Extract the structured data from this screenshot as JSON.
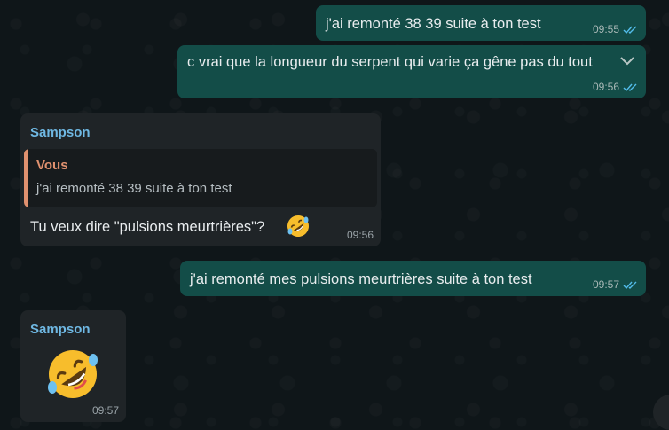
{
  "colors": {
    "outgoing_bubble": "#134d48",
    "incoming_bubble": "#1f2427",
    "sender_name": "#6fb8e3",
    "quote_accent": "#e0916f",
    "read_ticks": "#53bdeb"
  },
  "messages": [
    {
      "direction": "outgoing",
      "text": "j'ai remonté 38 39 suite à ton test",
      "time": "09:55",
      "status": "read"
    },
    {
      "direction": "outgoing",
      "text": "c vrai que la longueur du serpent qui varie ça gêne pas du tout",
      "time": "09:56",
      "status": "read",
      "menu_icon": "chevron-down-icon"
    },
    {
      "direction": "incoming",
      "sender": "Sampson",
      "quote": {
        "author": "Vous",
        "text": "j'ai remonté 38 39 suite à ton test"
      },
      "text": "Tu veux dire \"pulsions meurtrières\"?",
      "emoji": "rolling-on-floor-laughing",
      "time": "09:56"
    },
    {
      "direction": "outgoing",
      "text": "j'ai remonté mes pulsions meurtrières suite à ton test",
      "time": "09:57",
      "status": "read"
    },
    {
      "direction": "incoming",
      "sender": "Sampson",
      "emoji": "rolling-on-floor-laughing",
      "time": "09:57"
    }
  ]
}
